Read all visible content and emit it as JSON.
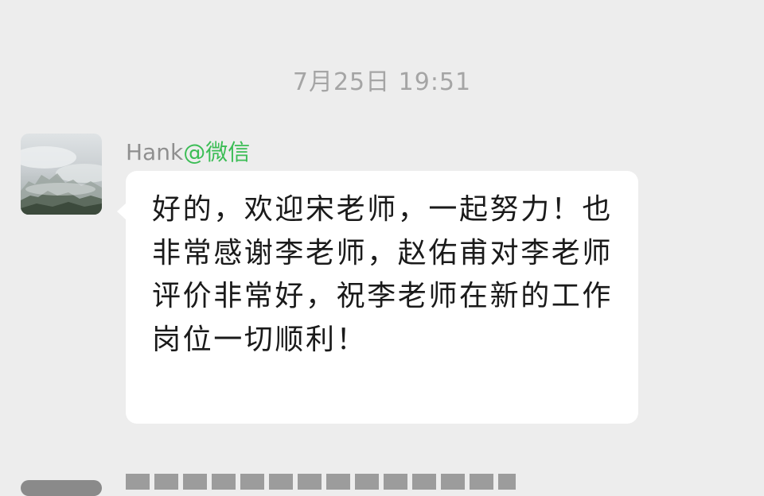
{
  "timestamp": "7月25日  19:51",
  "message": {
    "sender_name": "Hank",
    "sender_source": "@微信",
    "avatar_icon": "misty-mountain-photo",
    "text": "好的，欢迎宋老师，一起努力！也非常感谢李老师，赵佑甫对李老师评价非常好，祝李老师在新的工作岗位一切顺利！"
  },
  "colors": {
    "background": "#ededed",
    "bubble": "#ffffff",
    "timestamp": "#a5a5a5",
    "sender_name": "#8f8f8f",
    "sender_source": "#3bbd55"
  }
}
